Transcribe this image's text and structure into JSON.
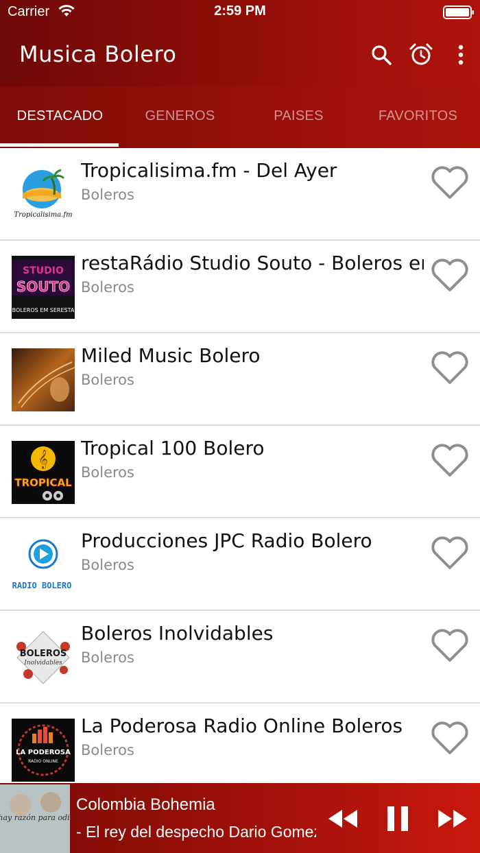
{
  "status_bar": {
    "carrier": "Carrier",
    "time": "2:59 PM"
  },
  "app_bar": {
    "title": "Musica Bolero",
    "icons": [
      "search-icon",
      "alarm-clock-icon",
      "more-vertical-icon"
    ]
  },
  "tabs": [
    {
      "label": "DESTACADO",
      "active": true
    },
    {
      "label": "GENEROS",
      "active": false
    },
    {
      "label": "PAISES",
      "active": false
    },
    {
      "label": "FAVORITOS",
      "active": false
    }
  ],
  "stations": [
    {
      "name": "Tropicalisima.fm - Del Ayer",
      "genre": "Boleros",
      "logo_text": "Tropicalisima.fm"
    },
    {
      "name": "restaRádio Studio Souto - Boleros em S",
      "genre": "Boleros",
      "logo_text": "STUDIO SOUTO",
      "logo_sub": "BOLEROS EM SERESTA"
    },
    {
      "name": "Miled Music Bolero",
      "genre": "Boleros"
    },
    {
      "name": "Tropical 100 Bolero",
      "genre": "Boleros",
      "logo_text": "TROPICAL"
    },
    {
      "name": "Producciones JPC Radio Bolero",
      "genre": "Boleros",
      "logo_text": "RADIO BOLERO"
    },
    {
      "name": "Boleros Inolvidables",
      "genre": "Boleros",
      "logo_text": "BOLEROS",
      "logo_sub": "Inolvidables"
    },
    {
      "name": "La Poderosa Radio Online Boleros",
      "genre": "Boleros",
      "logo_text": "LA PODEROSA",
      "logo_sub": "RADIO ONLINE"
    }
  ],
  "player": {
    "station": "Colombia Bohemia",
    "track": "- El rey del despecho   Dario Gomez",
    "art_text": "No hay razón para odiarte",
    "controls": [
      "rewind-icon",
      "pause-icon",
      "fast-forward-icon"
    ]
  },
  "colors": {
    "accent": "#8c0d08",
    "heart": "#8e8e8e"
  }
}
